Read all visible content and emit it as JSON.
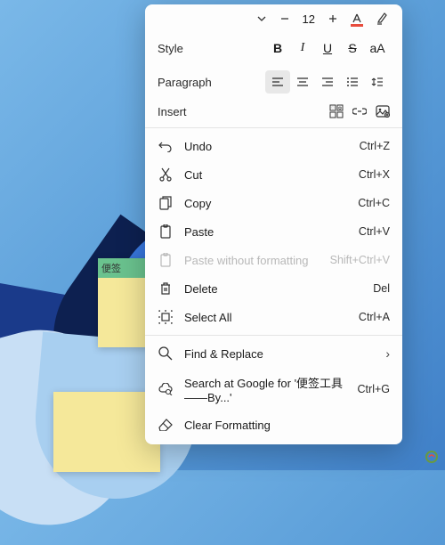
{
  "background": {
    "sticky_label": "便签"
  },
  "toolbar": {
    "font_size": "12"
  },
  "sections": {
    "style": "Style",
    "paragraph": "Paragraph",
    "insert": "Insert"
  },
  "menu": {
    "undo": {
      "label": "Undo",
      "shortcut": "Ctrl+Z"
    },
    "cut": {
      "label": "Cut",
      "shortcut": "Ctrl+X"
    },
    "copy": {
      "label": "Copy",
      "shortcut": "Ctrl+C"
    },
    "paste": {
      "label": "Paste",
      "shortcut": "Ctrl+V"
    },
    "paste_plain": {
      "label": "Paste without formatting",
      "shortcut": "Shift+Ctrl+V"
    },
    "delete": {
      "label": "Delete",
      "shortcut": "Del"
    },
    "select_all": {
      "label": "Select All",
      "shortcut": "Ctrl+A"
    },
    "find_replace": {
      "label": "Find & Replace"
    },
    "search_google": {
      "label": "Search at Google for '便签工具——By...'",
      "shortcut": "Ctrl+G"
    },
    "clear_format": {
      "label": "Clear Formatting"
    }
  },
  "style_buttons": {
    "bold": "B",
    "italic": "I",
    "underline": "U",
    "strike": "S",
    "case": "aA"
  }
}
